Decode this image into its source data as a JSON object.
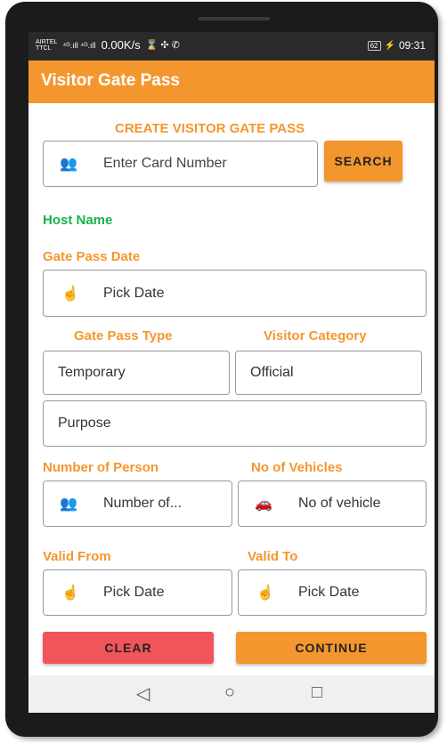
{
  "status": {
    "carrier_top": "AIRTEL",
    "carrier_bottom": "TTCL",
    "signal": "⁴ᴳ.ıll ⁴ᴳ.ıll",
    "speed": "0.00K/s",
    "icons": "⌛ ✣ ✆",
    "battery": "62",
    "time": "09:31"
  },
  "appbar": {
    "title": "Visitor Gate Pass"
  },
  "form": {
    "heading": "CREATE VISITOR GATE PASS",
    "card_placeholder": "Enter Card Number",
    "search_label": "SEARCH",
    "host_name_label": "Host Name",
    "gate_pass_date_label": "Gate Pass Date",
    "gate_pass_date_value": "Pick Date",
    "gate_pass_type_label": "Gate Pass Type",
    "visitor_category_label": "Visitor Category",
    "gate_pass_type_value": "Temporary",
    "visitor_category_value": "Official",
    "purpose_placeholder": "Purpose",
    "number_of_person_label": "Number of Person",
    "no_of_vehicles_label": "No of Vehicles",
    "number_of_person_placeholder": "Number of...",
    "no_of_vehicles_placeholder": "No of vehicle",
    "valid_from_label": "Valid From",
    "valid_to_label": "Valid To",
    "valid_from_value": "Pick Date",
    "valid_to_value": "Pick Date",
    "clear_label": "CLEAR",
    "continue_label": "CONTINUE"
  },
  "icons": {
    "people": "people-icon",
    "hand": "pointing-hand-icon",
    "car": "car-icon"
  },
  "nav": {
    "back": "◁",
    "home": "○",
    "recents": "□"
  },
  "colors": {
    "accent": "#f4962e",
    "host": "#18b24a",
    "clear": "#f2545b"
  }
}
